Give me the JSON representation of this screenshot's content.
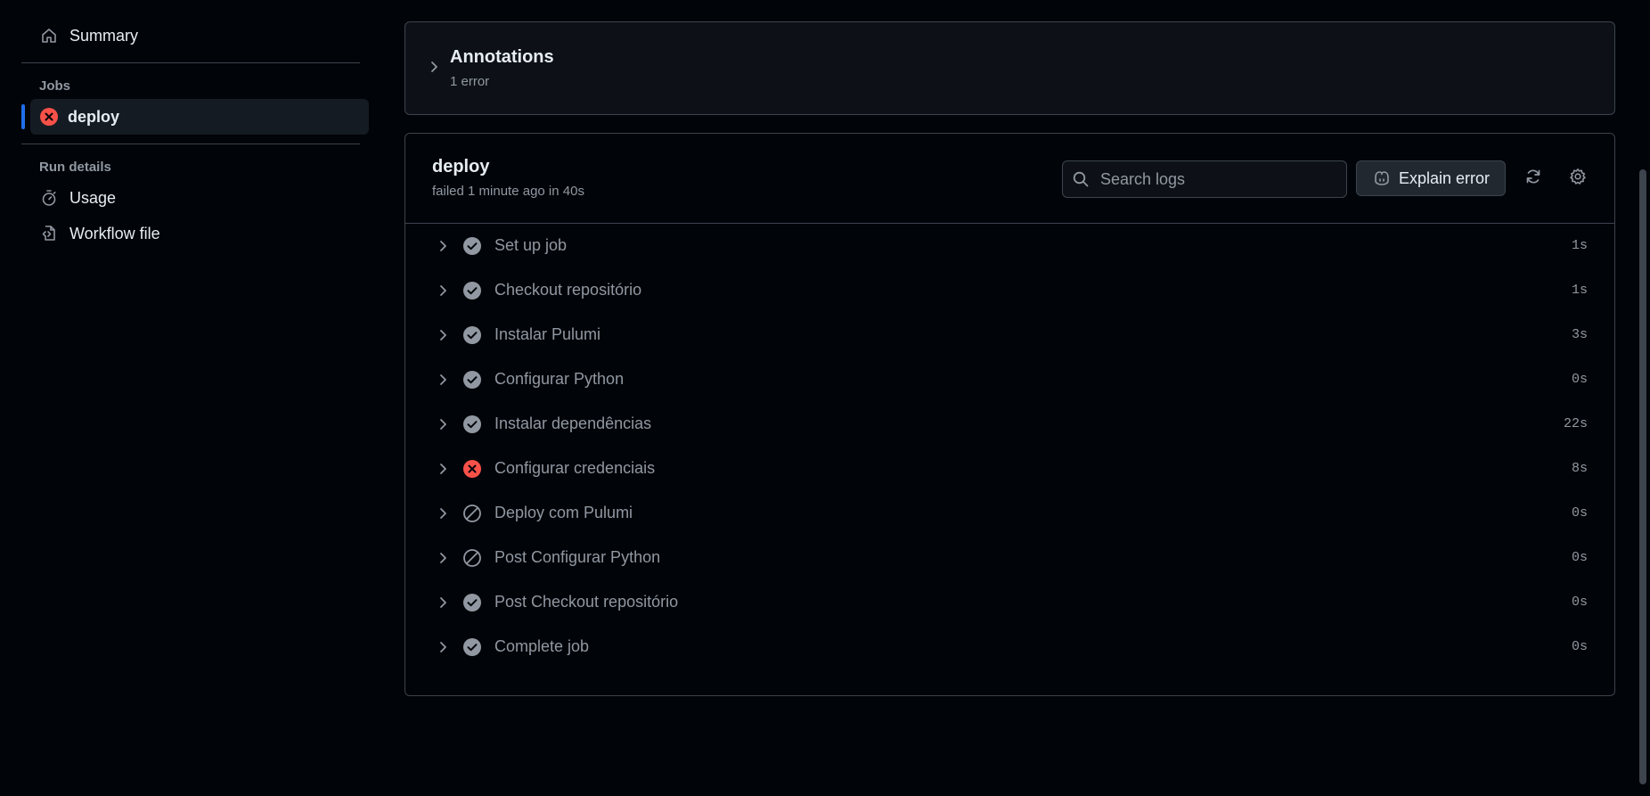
{
  "sidebar": {
    "summary_label": "Summary",
    "jobs_heading": "Jobs",
    "job": {
      "label": "deploy",
      "status": "failed"
    },
    "run_details_heading": "Run details",
    "usage_label": "Usage",
    "workflow_file_label": "Workflow file"
  },
  "annotations": {
    "title": "Annotations",
    "count_label": "1 error"
  },
  "job": {
    "title": "deploy",
    "subtitle": "failed 1 minute ago in 40s",
    "search_placeholder": "Search logs",
    "explain_label": "Explain error",
    "steps": [
      {
        "name": "Set up job",
        "duration": "1s",
        "status": "success"
      },
      {
        "name": "Checkout repositório",
        "duration": "1s",
        "status": "success"
      },
      {
        "name": "Instalar Pulumi",
        "duration": "3s",
        "status": "success"
      },
      {
        "name": "Configurar Python",
        "duration": "0s",
        "status": "success"
      },
      {
        "name": "Instalar dependências",
        "duration": "22s",
        "status": "success"
      },
      {
        "name": "Configurar credenciais",
        "duration": "8s",
        "status": "failure"
      },
      {
        "name": "Deploy com Pulumi",
        "duration": "0s",
        "status": "skipped"
      },
      {
        "name": "Post Configurar Python",
        "duration": "0s",
        "status": "skipped"
      },
      {
        "name": "Post Checkout repositório",
        "duration": "0s",
        "status": "success"
      },
      {
        "name": "Complete job",
        "duration": "0s",
        "status": "success"
      }
    ]
  },
  "colors": {
    "background": "#010409",
    "panel": "#0d1117",
    "border": "#3d444d",
    "accent": "#1f6feb",
    "error": "#f85149",
    "muted": "#9198a1"
  }
}
